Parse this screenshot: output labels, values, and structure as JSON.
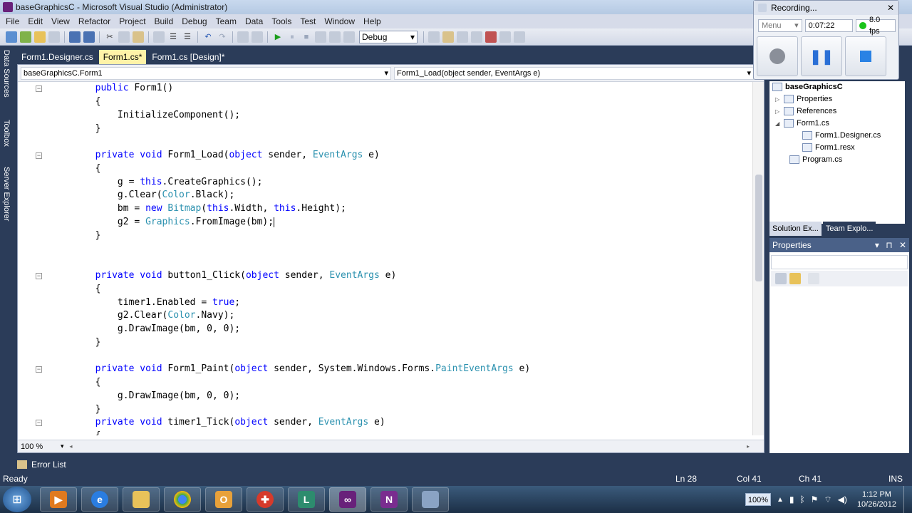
{
  "window": {
    "title": "baseGraphicsC - Microsoft Visual Studio (Administrator)"
  },
  "menu": [
    "File",
    "Edit",
    "View",
    "Refactor",
    "Project",
    "Build",
    "Debug",
    "Team",
    "Data",
    "Tools",
    "Test",
    "Window",
    "Help"
  ],
  "toolbar": {
    "config_value": "Debug"
  },
  "left_dock": {
    "tabs": [
      "Data Sources",
      "Toolbox",
      "Server Explorer"
    ]
  },
  "doc_tabs": [
    {
      "label": "Form1.Designer.cs",
      "active": false
    },
    {
      "label": "Form1.cs*",
      "active": true
    },
    {
      "label": "Form1.cs [Design]*",
      "active": false
    }
  ],
  "nav": {
    "class_dropdown": "baseGraphicsC.Form1",
    "member_dropdown": "Form1_Load(object sender, EventArgs e)"
  },
  "code_lines": [
    "        public Form1()",
    "        {",
    "            InitializeComponent();",
    "        }",
    "",
    "        private void Form1_Load(object sender, EventArgs e)",
    "        {",
    "            g = this.CreateGraphics();",
    "            g.Clear(Color.Black);",
    "            bm = new Bitmap(this.Width, this.Height);",
    "            g2 = Graphics.FromImage(bm);",
    "        }",
    "",
    "",
    "        private void button1_Click(object sender, EventArgs e)",
    "        {",
    "            timer1.Enabled = true;",
    "            g2.Clear(Color.Navy);",
    "            g.DrawImage(bm, 0, 0);",
    "        }",
    "",
    "        private void Form1_Paint(object sender, System.Windows.Forms.PaintEventArgs e)",
    "        {",
    "            g.DrawImage(bm, 0, 0);",
    "        }",
    "        private void timer1_Tick(object sender, EventArgs e)",
    "        {"
  ],
  "editor": {
    "zoom": "100 %"
  },
  "recording": {
    "title": "Recording...",
    "menu_label": "Menu",
    "elapsed": "0:07:22",
    "fps": "8.0 fps"
  },
  "solution_explorer": {
    "project": "baseGraphicsC",
    "items": [
      {
        "label": "Properties",
        "level": 1
      },
      {
        "label": "References",
        "level": 1
      },
      {
        "label": "Form1.cs",
        "level": 1
      },
      {
        "label": "Form1.Designer.cs",
        "level": 2
      },
      {
        "label": "Form1.resx",
        "level": 2
      },
      {
        "label": "Program.cs",
        "level": 1
      }
    ],
    "tabs": [
      "Solution Ex...",
      "Team Explo..."
    ]
  },
  "properties": {
    "title": "Properties"
  },
  "error_list": {
    "label": "Error List"
  },
  "status": {
    "ready": "Ready",
    "ln": "Ln 28",
    "col": "Col 41",
    "ch": "Ch 41",
    "mode": "INS"
  },
  "taskbar": {
    "battery": "100%",
    "time": "1:12 PM",
    "date": "10/26/2012"
  },
  "colors": {
    "keyword": "#0000ff",
    "type": "#2b91af",
    "ide_bg": "#2b3c59",
    "active_tab": "#fff3a8"
  }
}
